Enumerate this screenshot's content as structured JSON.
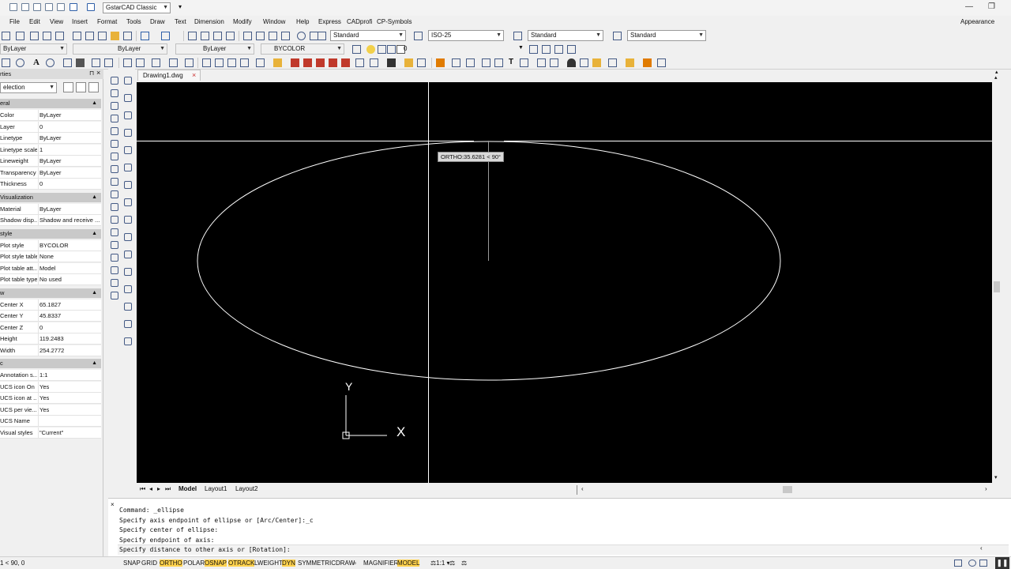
{
  "title_bar": {
    "workspace": "GstarCAD Classic"
  },
  "menu": [
    "File",
    "Edit",
    "View",
    "Insert",
    "Format",
    "Tools",
    "Draw",
    "Text",
    "Dimension",
    "Modify",
    "Window",
    "Help",
    "Express",
    "CADprofi",
    "CP-Symbols"
  ],
  "appearance": "Appearance",
  "toolbar_styles": {
    "text_style": "Standard",
    "dim_style": "ISO-25",
    "table_style": "Standard",
    "multileader_style": "Standard"
  },
  "toolbar_props": {
    "layer": "ByLayer",
    "linetype": "ByLayer",
    "lineweight": "ByLayer",
    "plotstyle": "BYCOLOR",
    "layer_name": "0"
  },
  "properties": {
    "title": "rties",
    "selection": "election",
    "sections": [
      {
        "name": "eral",
        "rows": [
          [
            "Color",
            "ByLayer"
          ],
          [
            "Layer",
            "0"
          ],
          [
            "Linetype",
            "ByLayer"
          ],
          [
            "Linetype scale",
            "1"
          ],
          [
            "Lineweight",
            "ByLayer"
          ],
          [
            "Transparency",
            "ByLayer"
          ],
          [
            "Thickness",
            "0"
          ]
        ]
      },
      {
        "name": "Visualization",
        "rows": [
          [
            "Material",
            "ByLayer"
          ],
          [
            "Shadow disp...",
            "Shadow and receive ..."
          ]
        ]
      },
      {
        "name": "style",
        "rows": [
          [
            "Plot style",
            "BYCOLOR"
          ],
          [
            "Plot style table",
            "None"
          ],
          [
            "Plot table att...",
            "Model"
          ],
          [
            "Plot table type",
            "No used"
          ]
        ]
      },
      {
        "name": "w",
        "rows": [
          [
            "Center X",
            "65.1827"
          ],
          [
            "Center Y",
            "45.8337"
          ],
          [
            "Center Z",
            "0"
          ],
          [
            "Height",
            "119.2483"
          ],
          [
            "Width",
            "254.2772"
          ]
        ]
      },
      {
        "name": "c",
        "rows": [
          [
            "Annotation s...",
            "1:1"
          ],
          [
            "UCS icon On",
            "Yes"
          ],
          [
            "UCS icon at ...",
            "Yes"
          ],
          [
            "UCS per vie...",
            "Yes"
          ],
          [
            "UCS Name",
            ""
          ],
          [
            "Visual styles",
            "\"Current\""
          ]
        ]
      }
    ]
  },
  "doc_tab": "Drawing1.dwg",
  "tooltip": "ORTHO:35.6281 < 90°",
  "ucs": {
    "x": "X",
    "y": "Y"
  },
  "layout_tabs": [
    "Model",
    "Layout1",
    "Layout2"
  ],
  "command_lines": [
    "Command: _ellipse",
    "Specify axis endpoint of ellipse or [Arc/Center]:_c",
    "Specify center of ellipse:",
    "Specify endpoint of axis:",
    "Specify distance to other axis or [Rotation]:"
  ],
  "status": {
    "coords": "1 < 90, 0",
    "toggles": [
      {
        "label": "SNAP",
        "on": false
      },
      {
        "label": "GRID",
        "on": false
      },
      {
        "label": "ORTHO",
        "on": true
      },
      {
        "label": "POLAR",
        "on": false
      },
      {
        "label": "OSNAP",
        "on": true
      },
      {
        "label": "OTRACK",
        "on": true
      },
      {
        "label": "LWEIGHT",
        "on": false
      },
      {
        "label": "DYN",
        "on": true
      },
      {
        "label": "SYMMETRICDRAW",
        "on": false
      },
      {
        "label": "MAGNIFIER",
        "on": false
      },
      {
        "label": "MODEL",
        "on": true
      }
    ],
    "scale": "1:1"
  }
}
